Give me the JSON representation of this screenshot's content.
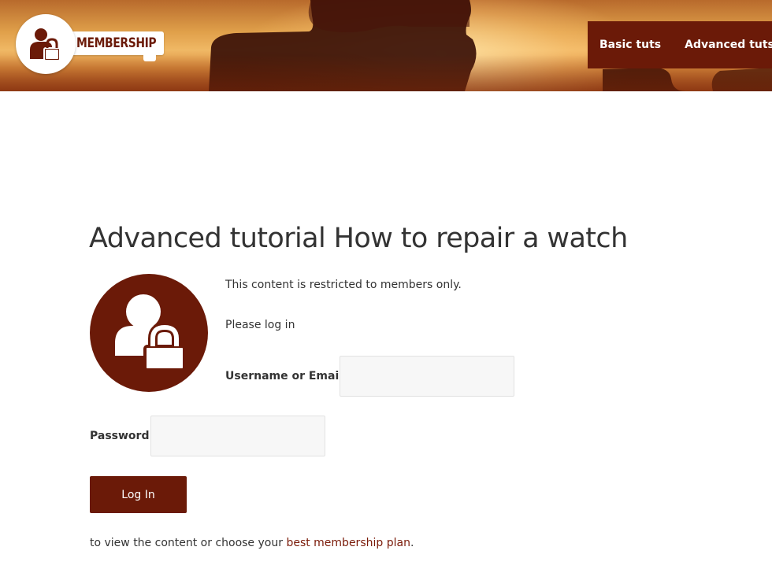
{
  "header": {
    "logo": {
      "text": "MEMBERSHIP",
      "icon": "user-lock-icon"
    },
    "nav": [
      {
        "label": "Basic tuts"
      },
      {
        "label": "Advanced tuts"
      }
    ],
    "colors": {
      "brand": "#6b1a08",
      "sky_light": "#f0b865",
      "sky_dark": "#a94d1e"
    }
  },
  "main": {
    "title": "Advanced tutorial How to repair a watch",
    "avatar_icon": "user-lock-icon",
    "notice": "This content is restricted to members only.",
    "please": "Please log in",
    "form": {
      "username_label": "Username or Email",
      "username_value": "",
      "password_label": "Password",
      "password_value": "",
      "submit_label": "Log In"
    },
    "footer": {
      "prefix": "to view the content or choose your ",
      "link": "best membership plan",
      "suffix": "."
    }
  }
}
